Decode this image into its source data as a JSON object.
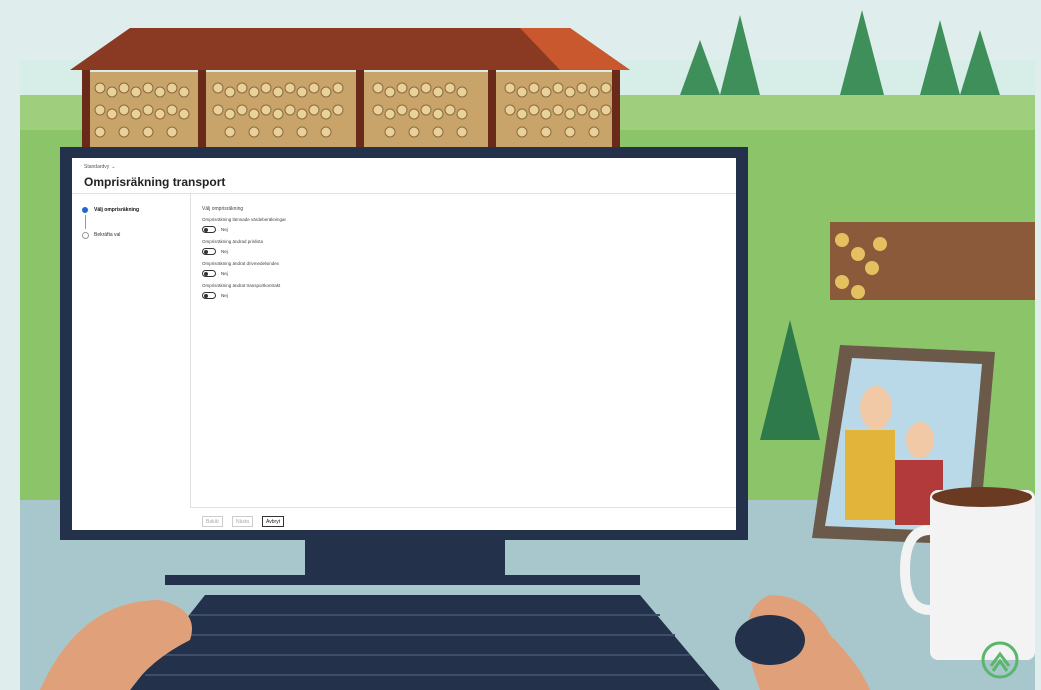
{
  "colors": {
    "accent": "#2266cc",
    "sky": "#dff0ee",
    "grass": "#7bbf5a",
    "roof": "#8a3a22",
    "bezel": "#23324a"
  },
  "header": {
    "view_selector": "Standardvy",
    "title": "Omprisräkning transport"
  },
  "steps": [
    {
      "label": "Välj omprisräkning",
      "active": true
    },
    {
      "label": "Bekräfta val",
      "active": false
    }
  ],
  "form": {
    "heading": "Välj omprisräkning",
    "fields": [
      {
        "label": "Omprisräkning lämnade värdeberäkningar",
        "value": "Nej"
      },
      {
        "label": "Omprisräkning ändrad prislista",
        "value": "Nej"
      },
      {
        "label": "Omprisräkning ändrat drivmedelsindex",
        "value": "Nej"
      },
      {
        "label": "Omprisräkning ändrat transportkontrakt",
        "value": "Nej"
      }
    ]
  },
  "footer": {
    "back_label": "Bakåt",
    "next_label": "Nästa",
    "cancel_label": "Avbryt"
  },
  "icons": {
    "view_chevron": "chevron-down-icon",
    "logo": "tree-logo-icon"
  }
}
